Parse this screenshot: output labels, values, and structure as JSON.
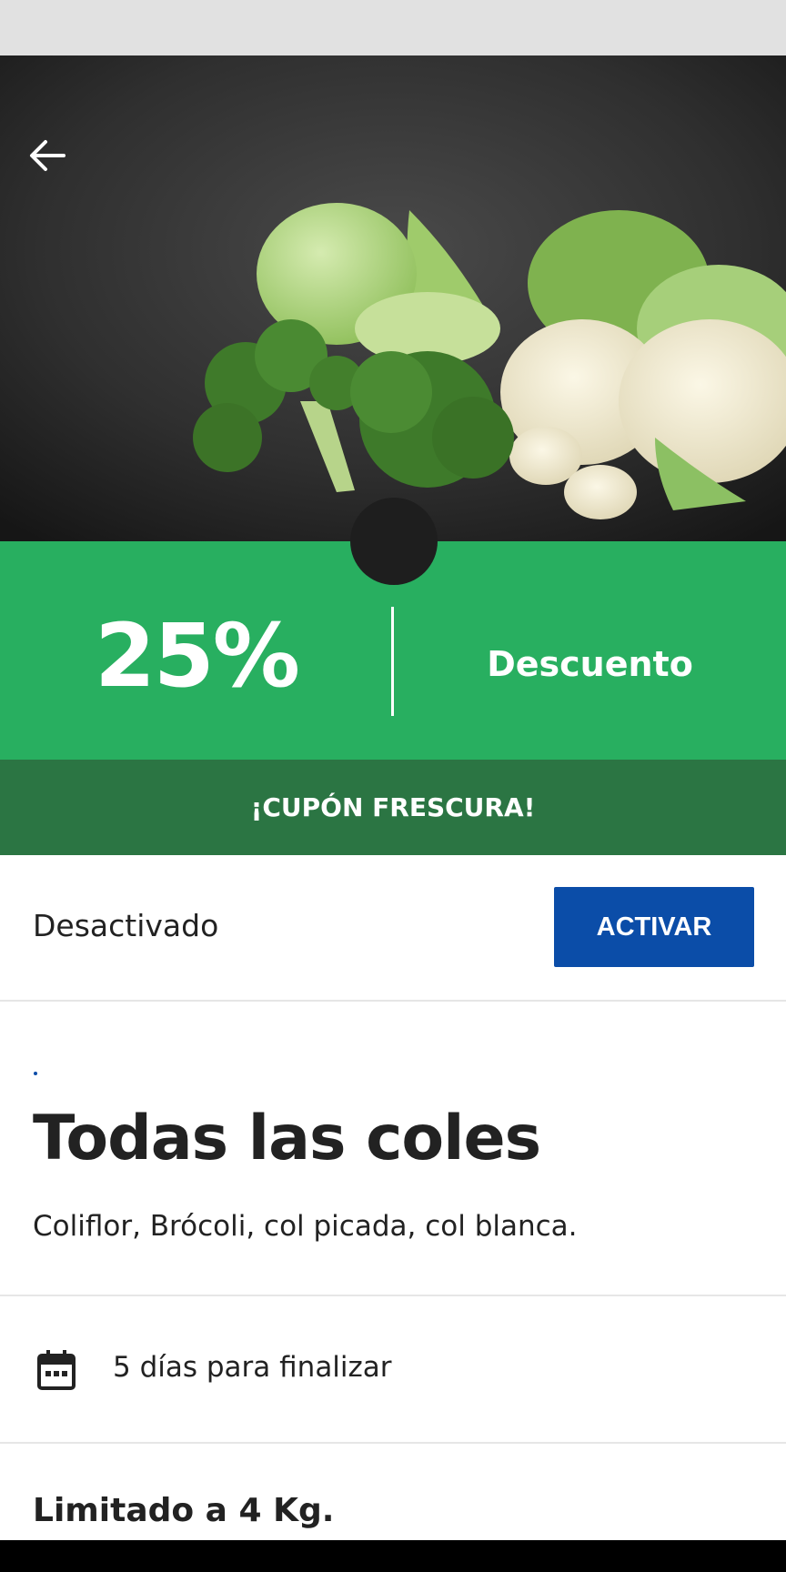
{
  "header": {
    "back_icon": "arrow-left-icon"
  },
  "hero": {
    "image_subject": "vegetables-cabbage-broccoli-cauliflower"
  },
  "promo": {
    "percent": "25%",
    "discount_label": "Descuento",
    "banner_label": "¡CUPÓN FRESCURA!",
    "colors": {
      "green": "#28af60",
      "dark_green": "#2b7543"
    }
  },
  "coupon": {
    "status_text": "Desactivado",
    "activate_label": "ACTIVAR",
    "button_color": "#0b4da8"
  },
  "product": {
    "title": "Todas las coles",
    "description": "Coliflor, Brócoli, col picada, col blanca."
  },
  "validity": {
    "icon": "calendar-icon",
    "text": "5 días para finalizar"
  },
  "limit": {
    "text": "Limitado a 4 Kg."
  }
}
